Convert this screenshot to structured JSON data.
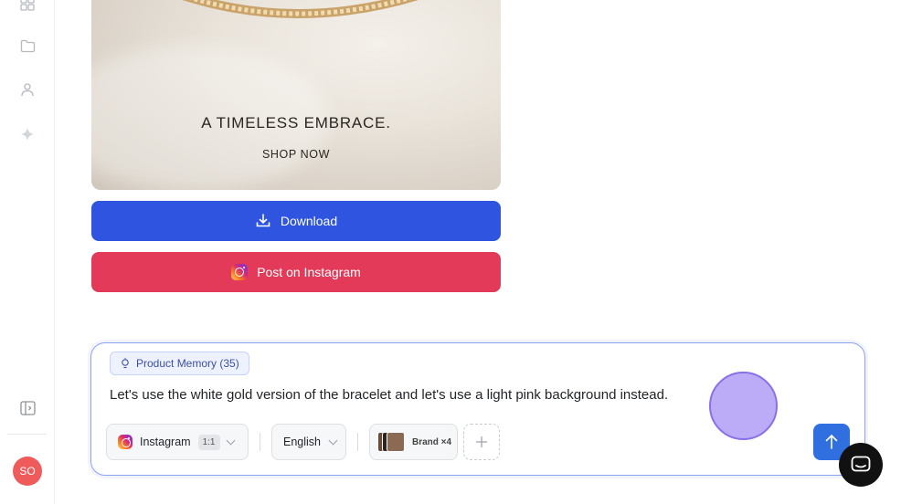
{
  "sidebar": {
    "icons": [
      "grid-icon",
      "folder-icon",
      "user-icon",
      "sparkle-icon",
      "collapse-panel-icon"
    ],
    "avatar_initials": "SO"
  },
  "hero": {
    "title": "A TIMELESS EMBRACE.",
    "cta": "SHOP NOW"
  },
  "actions": {
    "download_label": "Download",
    "post_label": "Post on Instagram"
  },
  "composer": {
    "memory_chip": "Product Memory (35)",
    "prompt": "Let's use the white gold version of the bracelet and let's use a light pink background instead.",
    "platform": "Instagram",
    "ratio": "1:1",
    "language": "English",
    "brand_label": "Brand ×4"
  },
  "colors": {
    "download": "#2f55e0",
    "instagram": "#e23a58",
    "send": "#2f6fe0",
    "accent_border": "#8aa4f2"
  }
}
